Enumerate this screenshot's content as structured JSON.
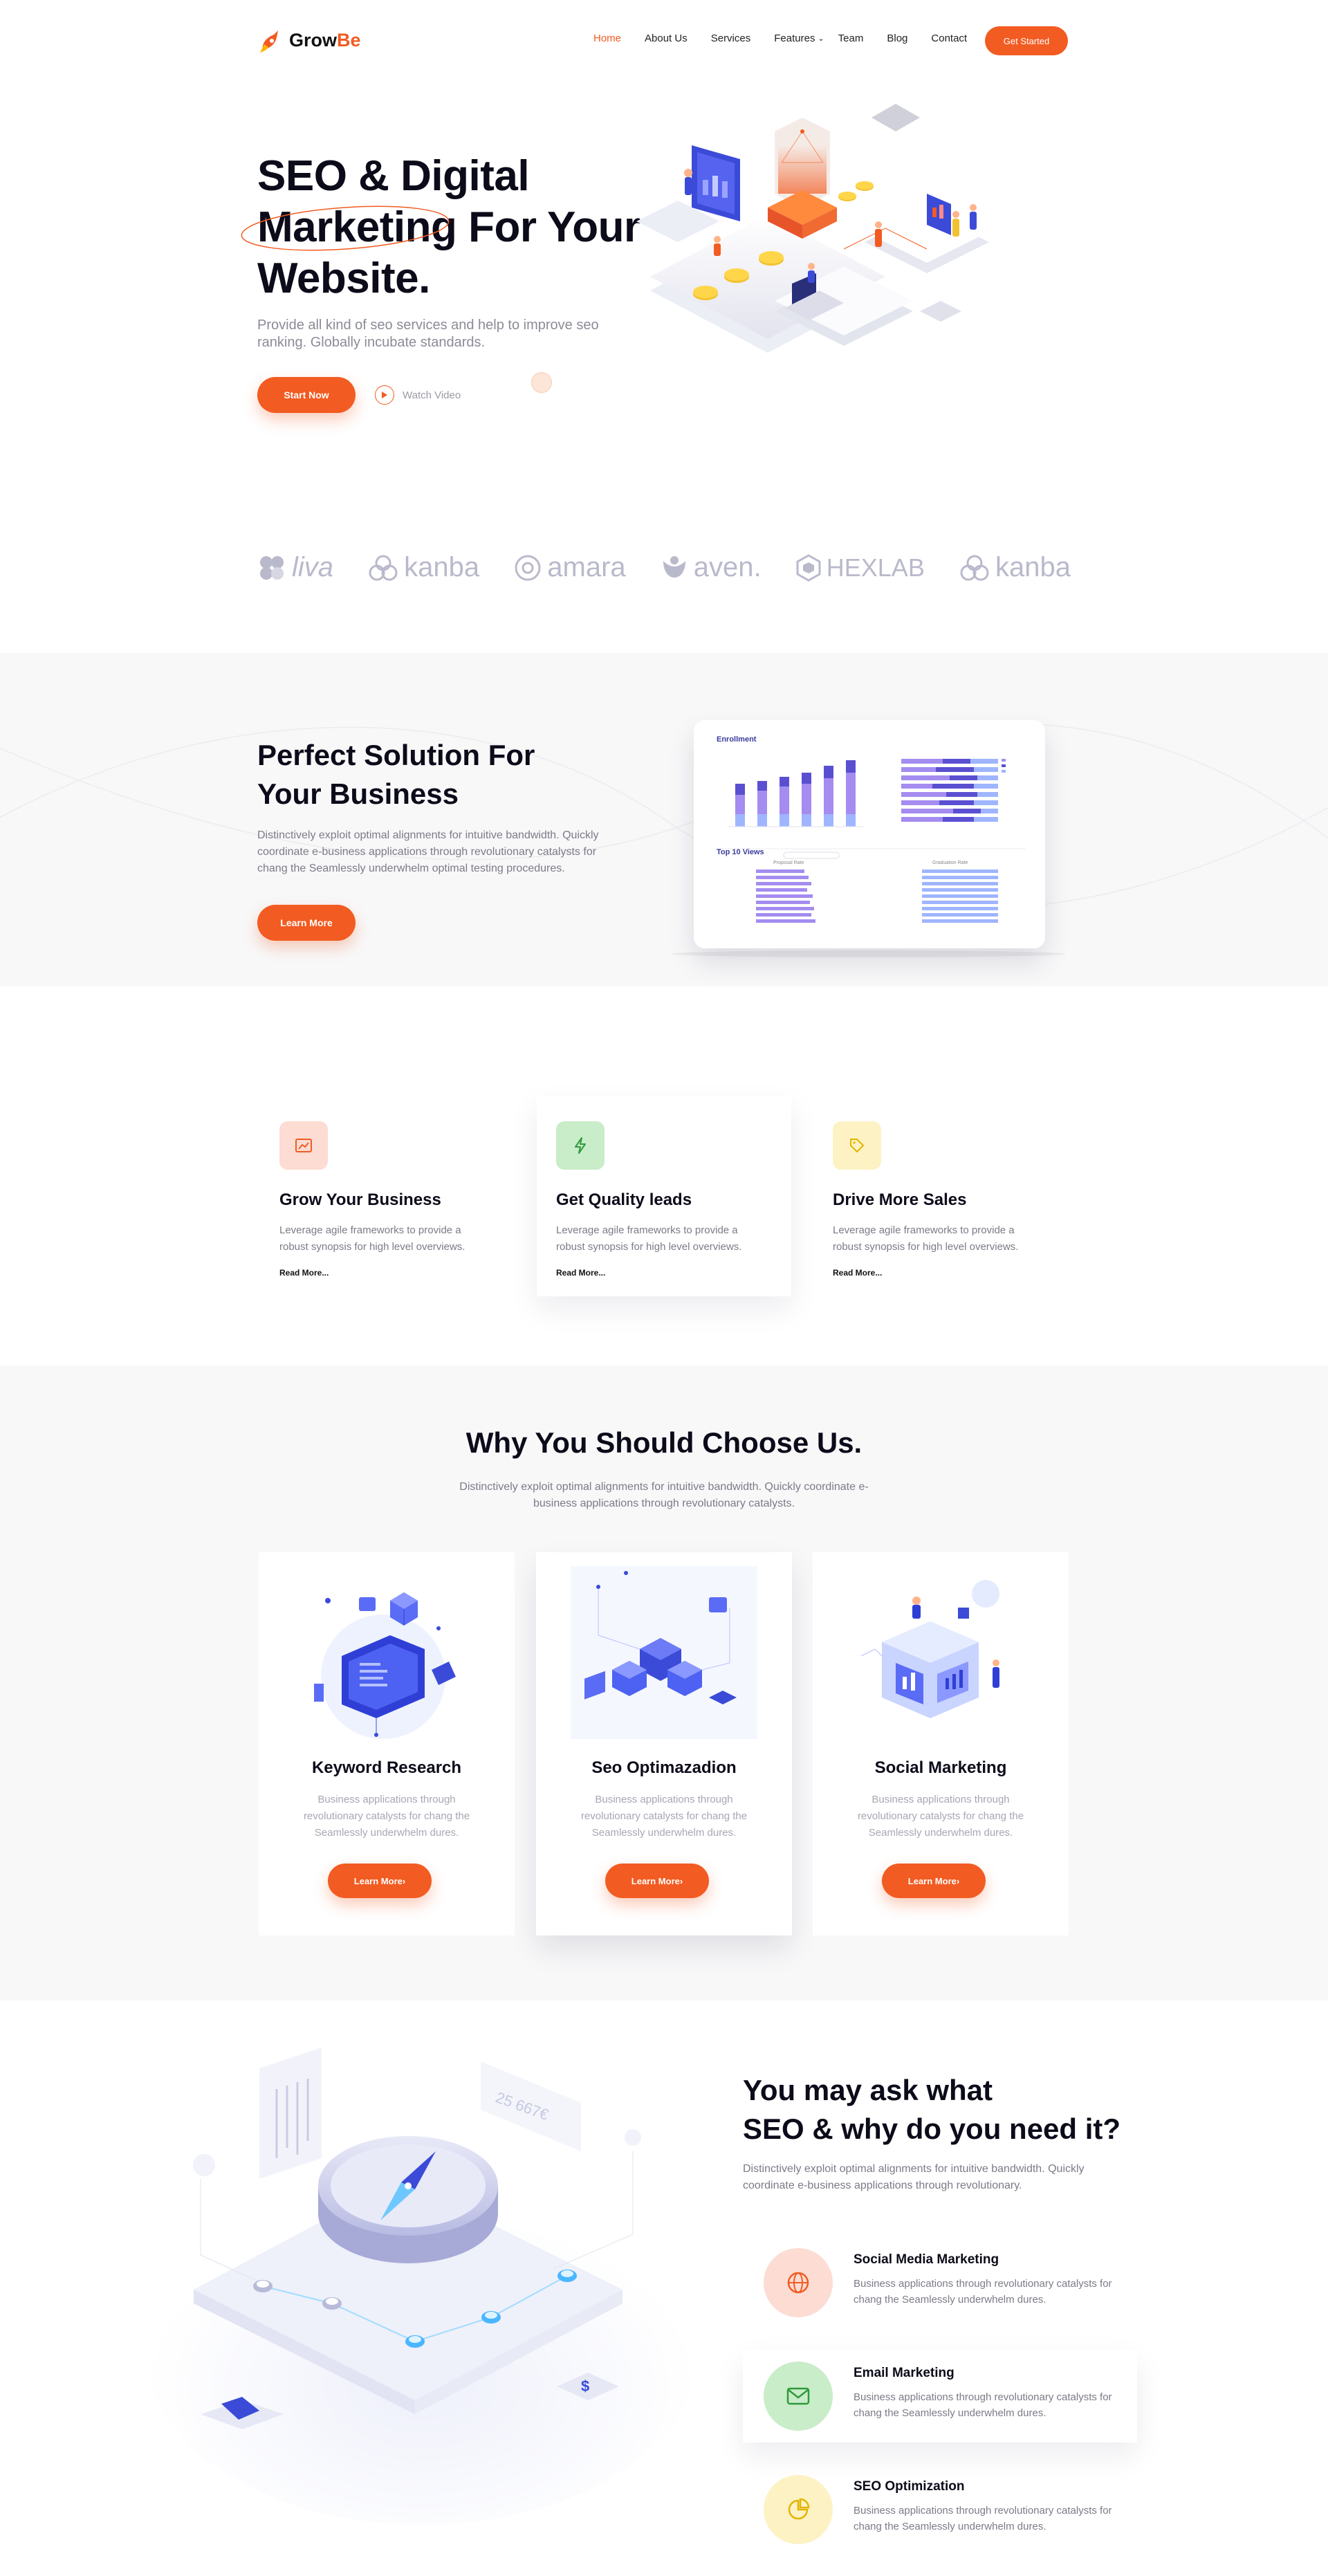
{
  "header": {
    "logo_text_a": "Grow",
    "logo_text_b": "Be",
    "nav": [
      "Home",
      "About Us",
      "Services",
      "Features",
      "Team",
      "Blog",
      "Contact"
    ],
    "cta": "Get Started"
  },
  "hero": {
    "title_line1": "SEO & Digital",
    "title_line2a": "Marketing",
    "title_line2b": " For Your",
    "title_line3": "Website.",
    "subtitle": "Provide all kind of seo services and help to improve seo ranking. Globally incubate standards.",
    "start_button": "Start Now",
    "watch_video": "Watch Video"
  },
  "brands": [
    "liva",
    "kanba",
    "amara",
    "aven.",
    "HEXLAB",
    "kanba"
  ],
  "solution": {
    "title_line1": "Perfect Solution For",
    "title_line2": "Your Business",
    "text": "Distinctively exploit optimal alignments for intuitive bandwidth. Quickly coordinate e-business applications through revolutionary catalysts for chang the Seamlessly underwhelm optimal testing procedures.",
    "button": "Learn More",
    "dashboard": {
      "title1": "Enrollment",
      "title2": "Top 10 Views",
      "sub_left": "Proposal Rate",
      "sub_right": "Graduation Rate"
    }
  },
  "services": [
    {
      "title": "Grow Your Business",
      "text": "Leverage agile frameworks to provide a robust synopsis for high level overviews.",
      "link": "Read More...",
      "color": "#fcdcd3",
      "icon": "chart-icon"
    },
    {
      "title": "Get Quality leads",
      "text": "Leverage agile frameworks to provide a robust synopsis for high level overviews.",
      "link": "Read More...",
      "color": "#c9ecc9",
      "icon": "bolt-icon"
    },
    {
      "title": "Drive More Sales",
      "text": "Leverage agile frameworks to provide a robust synopsis for high level overviews.",
      "link": "Read More...",
      "color": "#fdf2c4",
      "icon": "tag-icon"
    }
  ],
  "choose": {
    "title": "Why You Should Choose Us.",
    "text": "Distinctively exploit optimal alignments for intuitive bandwidth. Quickly coordinate e-business applications through revolutionary catalysts.",
    "cards": [
      {
        "title": "Keyword Research",
        "text": "Business applications through revolutionary catalysts for chang the Seamlessly underwhelm dures.",
        "button": "Learn More"
      },
      {
        "title": "Seo Optimazadion",
        "text": "Business applications through revolutionary catalysts for chang the Seamlessly underwhelm dures.",
        "button": "Learn More"
      },
      {
        "title": "Social Marketing",
        "text": "Business applications through revolutionary catalysts for chang the Seamlessly underwhelm dures.",
        "button": "Learn More"
      }
    ]
  },
  "why": {
    "title_line1": "You may ask what",
    "title_line2": "SEO & why do you need it?",
    "text": "Distinctively exploit optimal alignments for intuitive bandwidth. Quickly coordinate e-business applications through revolutionary.",
    "illustration_text": "25 667€",
    "features": [
      {
        "title": "Social Media Marketing",
        "text": "Business applications through revolutionary catalysts for chang the Seamlessly underwhelm dures.",
        "icon": "globe-icon",
        "color": "#fcdcd3"
      },
      {
        "title": "Email Marketing",
        "text": "Business applications through revolutionary catalysts for chang the Seamlessly underwhelm dures.",
        "icon": "mail-icon",
        "color": "#c9ecc9"
      },
      {
        "title": "SEO Optimization",
        "text": "Business applications through revolutionary catalysts for chang the Seamlessly underwhelm dures.",
        "icon": "pie-icon",
        "color": "#fdf2c4"
      }
    ]
  },
  "colors": {
    "accent": "#f25b21",
    "heading": "#0b0b1a",
    "muted": "#7b7b88",
    "section_bg": "#f8f8f9"
  }
}
